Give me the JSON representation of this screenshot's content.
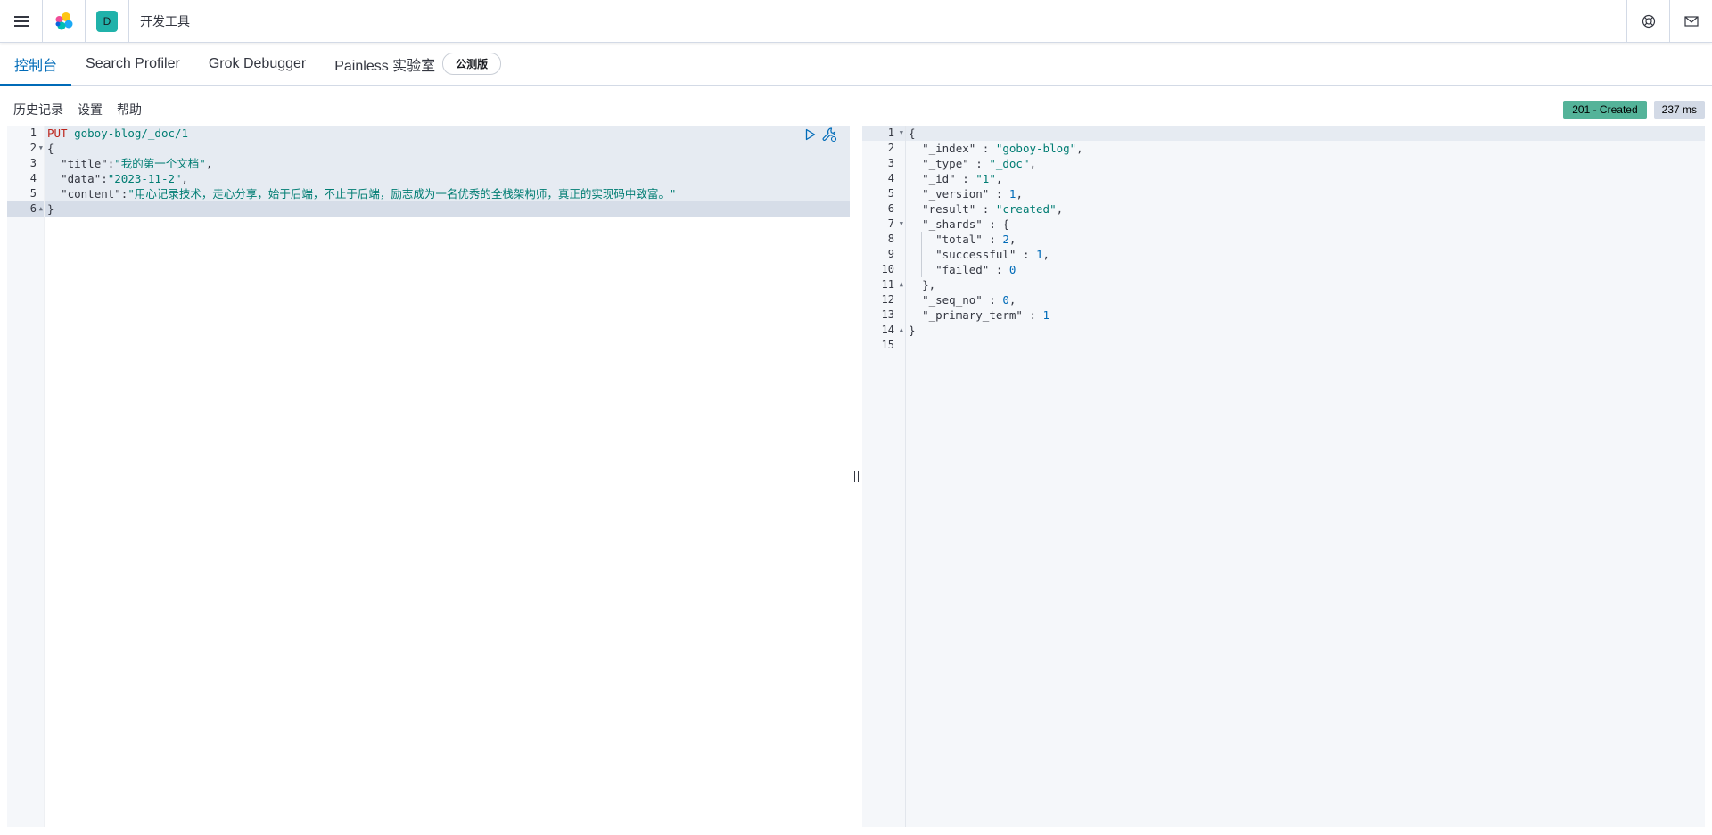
{
  "header": {
    "space_initial": "D",
    "breadcrumb": "开发工具"
  },
  "tabs": [
    {
      "label": "控制台",
      "active": true
    },
    {
      "label": "Search Profiler",
      "active": false
    },
    {
      "label": "Grok Debugger",
      "active": false
    },
    {
      "label": "Painless 实验室",
      "active": false,
      "badge": "公测版"
    }
  ],
  "toolbar": {
    "history": "历史记录",
    "settings": "设置",
    "help": "帮助",
    "status": "201 - Created",
    "time": "237 ms",
    "status_color": "#54b399"
  },
  "request": {
    "method": "PUT",
    "path": "goboy-blog/_doc/1",
    "line_numbers": [
      "1",
      "2",
      "3",
      "4",
      "5",
      "6"
    ],
    "title_key": "\"title\"",
    "title_val": "\"我的第一个文档\"",
    "data_key": "\"data\"",
    "data_val": "\"2023-11-2\"",
    "content_key": "\"content\"",
    "content_val": "\"用心记录技术，走心分享，始于后端，不止于后端，励志成为一名优秀的全栈架构师，真正的实现码中致富。\""
  },
  "response": {
    "line_numbers": [
      "1",
      "2",
      "3",
      "4",
      "5",
      "6",
      "7",
      "8",
      "9",
      "10",
      "11",
      "12",
      "13",
      "14",
      "15"
    ],
    "index_key": "\"_index\"",
    "index_val": "\"goboy-blog\"",
    "type_key": "\"_type\"",
    "type_val": "\"_doc\"",
    "id_key": "\"_id\"",
    "id_val": "\"1\"",
    "version_key": "\"_version\"",
    "version_val": "1",
    "result_key": "\"result\"",
    "result_val": "\"created\"",
    "shards_key": "\"_shards\"",
    "total_key": "\"total\"",
    "total_val": "2",
    "successful_key": "\"successful\"",
    "successful_val": "1",
    "failed_key": "\"failed\"",
    "failed_val": "0",
    "seq_key": "\"_seq_no\"",
    "seq_val": "0",
    "primary_key": "\"_primary_term\"",
    "primary_val": "1"
  }
}
